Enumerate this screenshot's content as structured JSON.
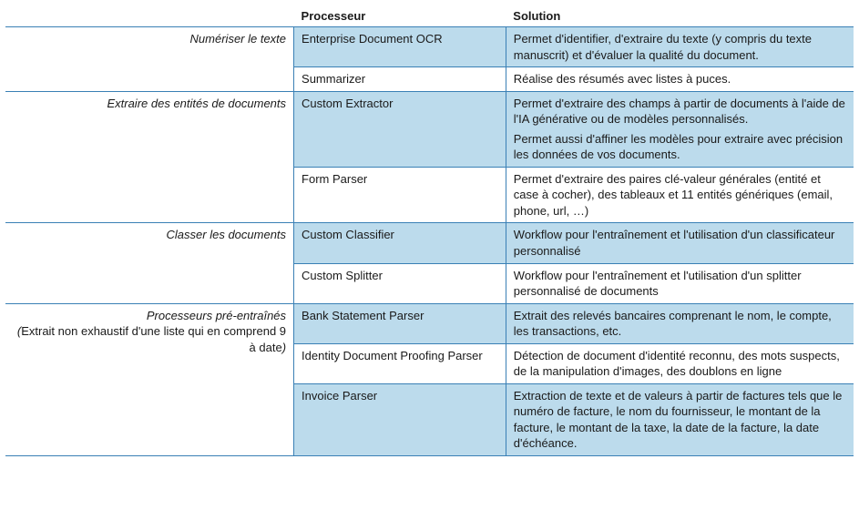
{
  "headers": {
    "cat": "",
    "proc": "Processeur",
    "sol": "Solution"
  },
  "groups": [
    {
      "category": "Numériser le texte",
      "category_sub": "",
      "rows": [
        {
          "proc": "Enterprise Document OCR",
          "sol": "Permet d'identifier, d'extraire du texte (y compris du texte manuscrit) et d'évaluer la qualité du document.",
          "shaded": true
        },
        {
          "proc": "Summarizer",
          "sol": "Réalise des résumés avec listes à puces.",
          "shaded": false
        }
      ]
    },
    {
      "category": "Extraire des entités de documents",
      "category_sub": "",
      "rows": [
        {
          "proc": "Custom Extractor",
          "sol": "Permet d'extraire des champs à partir de documents à l'aide de l'IA générative ou de modèles personnalisés.\nPermet aussi d'affiner les modèles pour extraire avec précision les données de vos documents.",
          "shaded": true
        },
        {
          "proc": "Form Parser",
          "sol": "Permet d'extraire des paires clé-valeur générales (entité et case à cocher), des tableaux et 11 entités génériques (email, phone, url, …)",
          "shaded": false
        }
      ]
    },
    {
      "category": "Classer les documents",
      "category_sub": "",
      "rows": [
        {
          "proc": "Custom Classifier",
          "sol": "Workflow pour l'entraînement et l'utilisation d'un classificateur personnalisé",
          "shaded": true
        },
        {
          "proc": "Custom Splitter",
          "sol": "Workflow pour l'entraînement et l'utilisation d'un splitter personnalisé de documents",
          "shaded": false
        }
      ]
    },
    {
      "category": "Processeurs pré-entraînés",
      "category_sub": "(Extrait non exhaustif d'une liste qui en comprend 9 à date)",
      "rows": [
        {
          "proc": "Bank Statement Parser",
          "sol": "Extrait des relevés bancaires comprenant le nom, le compte, les transactions, etc.",
          "shaded": true
        },
        {
          "proc": "Identity Document Proofing Parser",
          "sol": "Détection de document d'identité reconnu, des mots suspects, de la manipulation d'images, des doublons en ligne",
          "shaded": false
        },
        {
          "proc": "Invoice Parser",
          "sol": "Extraction de texte et de valeurs à partir de factures tels que le numéro de facture, le nom du fournisseur, le montant de la facture, le montant de la taxe, la date de la facture, la date d'échéance.",
          "shaded": true
        }
      ]
    }
  ]
}
